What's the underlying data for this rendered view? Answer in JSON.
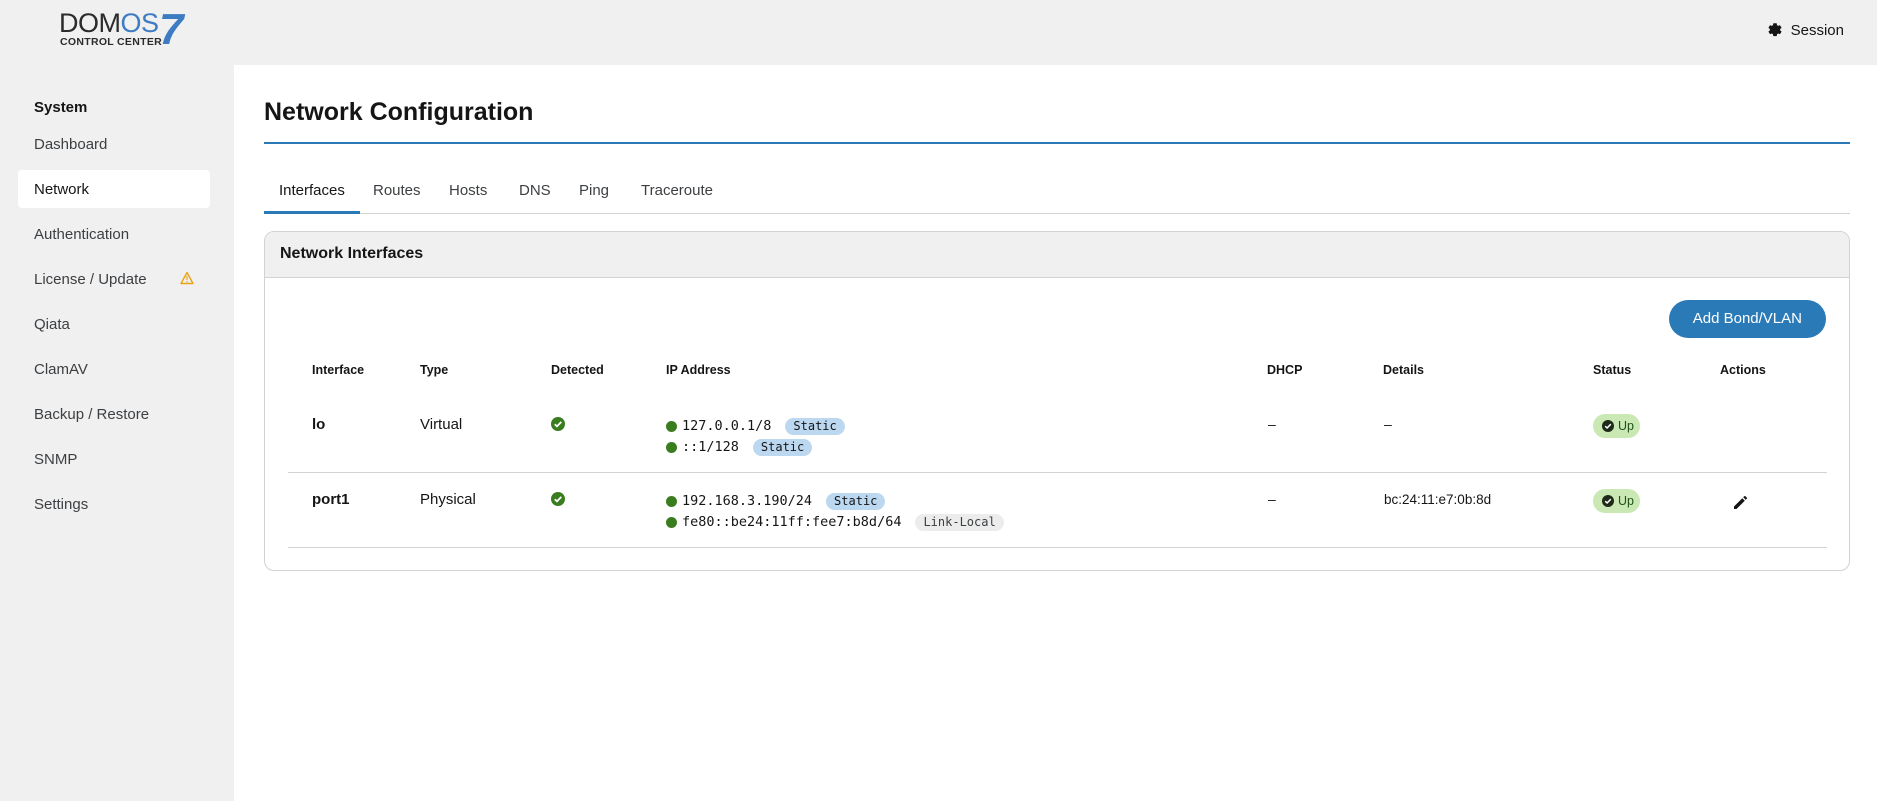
{
  "header": {
    "logo": {
      "brand_prefix": "DOM",
      "brand_accent": "OS",
      "version": "7",
      "subtitle": "CONTROL CENTER"
    },
    "session_label": "Session",
    "session_icon": "gear-icon"
  },
  "sidebar": {
    "section": "System",
    "items": [
      {
        "label": "Dashboard"
      },
      {
        "label": "Network",
        "active": true
      },
      {
        "label": "Authentication"
      },
      {
        "label": "License / Update",
        "icon": "warning-icon"
      },
      {
        "label": "Qiata"
      },
      {
        "label": "ClamAV"
      },
      {
        "label": "Backup / Restore"
      },
      {
        "label": "SNMP"
      },
      {
        "label": "Settings"
      }
    ]
  },
  "main": {
    "title": "Network Configuration",
    "tabs": [
      {
        "label": "Interfaces",
        "active": true
      },
      {
        "label": "Routes"
      },
      {
        "label": "Hosts"
      },
      {
        "label": "DNS"
      },
      {
        "label": "Ping"
      },
      {
        "label": "Traceroute"
      }
    ],
    "card": {
      "title": "Network Interfaces",
      "add_button": "Add Bond/VLAN",
      "columns": [
        "Interface",
        "Type",
        "Detected",
        "IP Address",
        "DHCP",
        "Details",
        "Status",
        "Actions"
      ],
      "rows": [
        {
          "interface": "lo",
          "type": "Virtual",
          "detected": "check-circle-icon",
          "ips": [
            {
              "address": "127.0.0.1/8",
              "tag": "Static"
            },
            {
              "address": "::1/128",
              "tag": "Static"
            }
          ],
          "dhcp": "–",
          "details": "–",
          "status": "Up"
        },
        {
          "interface": "port1",
          "type": "Physical",
          "detected": "check-circle-icon",
          "ips": [
            {
              "address": "192.168.3.190/24",
              "tag": "Static"
            },
            {
              "address": "fe80::be24:11ff:fee7:b8d/64",
              "tag": "Link-Local"
            }
          ],
          "dhcp": "–",
          "details": "bc:24:11:e7:0b:8d",
          "status": "Up",
          "action_icon": "pencil-icon"
        }
      ]
    }
  },
  "colors": {
    "accent": "#2b7ab8",
    "status_ok": "#3a7d1e",
    "status_badge_bg": "#c9e8b4",
    "static_badge_bg": "#bcd7f0",
    "warning": "#e8a317"
  }
}
